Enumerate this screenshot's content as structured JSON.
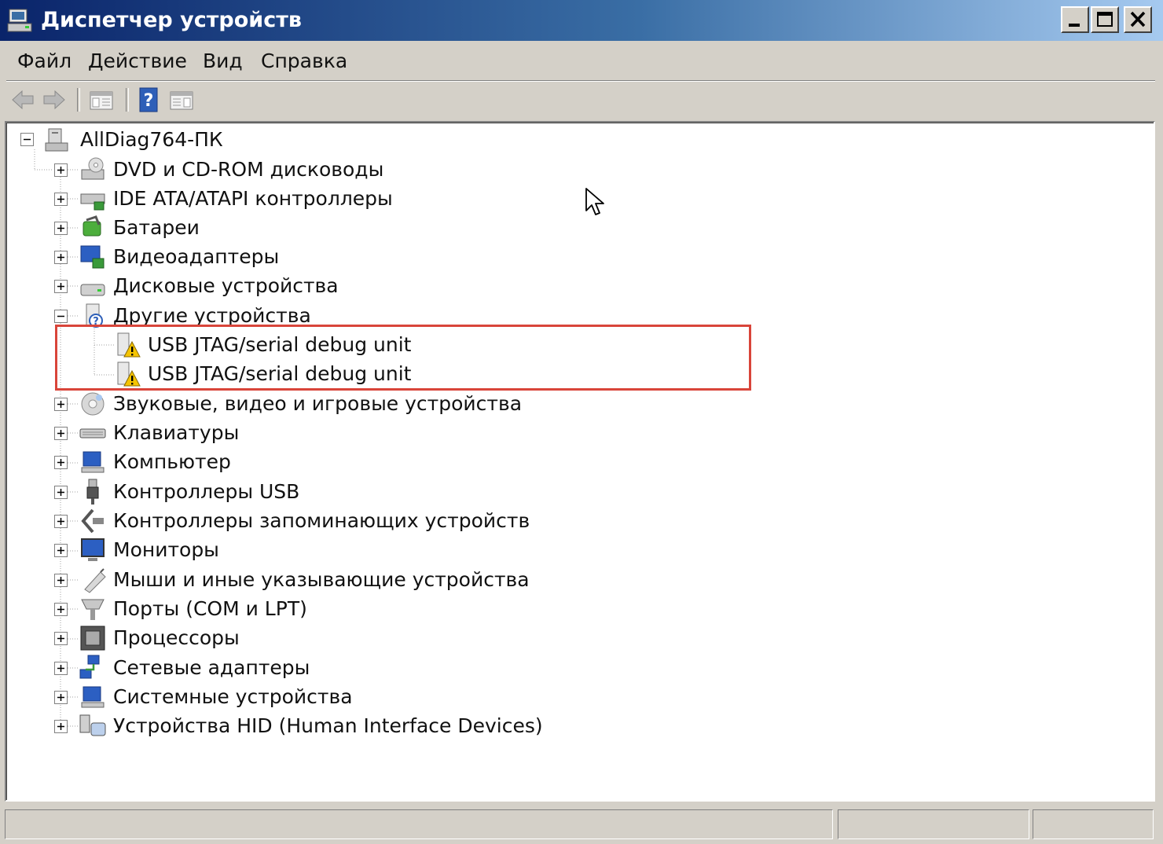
{
  "window": {
    "title": "Диспетчер устройств",
    "title_icon": "device-manager-icon",
    "controls": [
      "minimize",
      "maximize",
      "close"
    ]
  },
  "menu": {
    "file": "Файл",
    "action": "Действие",
    "view": "Вид",
    "help": "Справка"
  },
  "toolbar": {
    "buttons": [
      "back-arrow-icon",
      "forward-arrow-icon",
      "console-tree-icon",
      "help-icon",
      "properties-icon"
    ]
  },
  "tree": {
    "root": "AllDiag764-ПК",
    "categories": {
      "dvd": "DVD и CD-ROM дисководы",
      "ide": "IDE ATA/ATAPI контроллеры",
      "batteries": "Батареи",
      "video": "Видеоадаптеры",
      "disks": "Дисковые устройства",
      "other": "Другие устройства",
      "sound": "Звуковые, видео и игровые устройства",
      "keyboards": "Клавиатуры",
      "computer": "Компьютер",
      "usb": "Контроллеры USB",
      "storage": "Контроллеры запоминающих устройств",
      "monitors": "Мониторы",
      "mice": "Мыши и иные указывающие устройства",
      "ports": "Порты (COM и LPT)",
      "cpu": "Процессоры",
      "network": "Сетевые адаптеры",
      "system": "Системные устройства",
      "hid": "Устройства HID (Human Interface Devices)"
    },
    "other_children": [
      "USB JTAG/serial debug unit",
      "USB JTAG/serial debug unit"
    ]
  },
  "colors": {
    "highlight_border": "#d9453a",
    "title_start": "#0a246a",
    "title_end": "#a6caf0",
    "warning": "#f5c400"
  }
}
